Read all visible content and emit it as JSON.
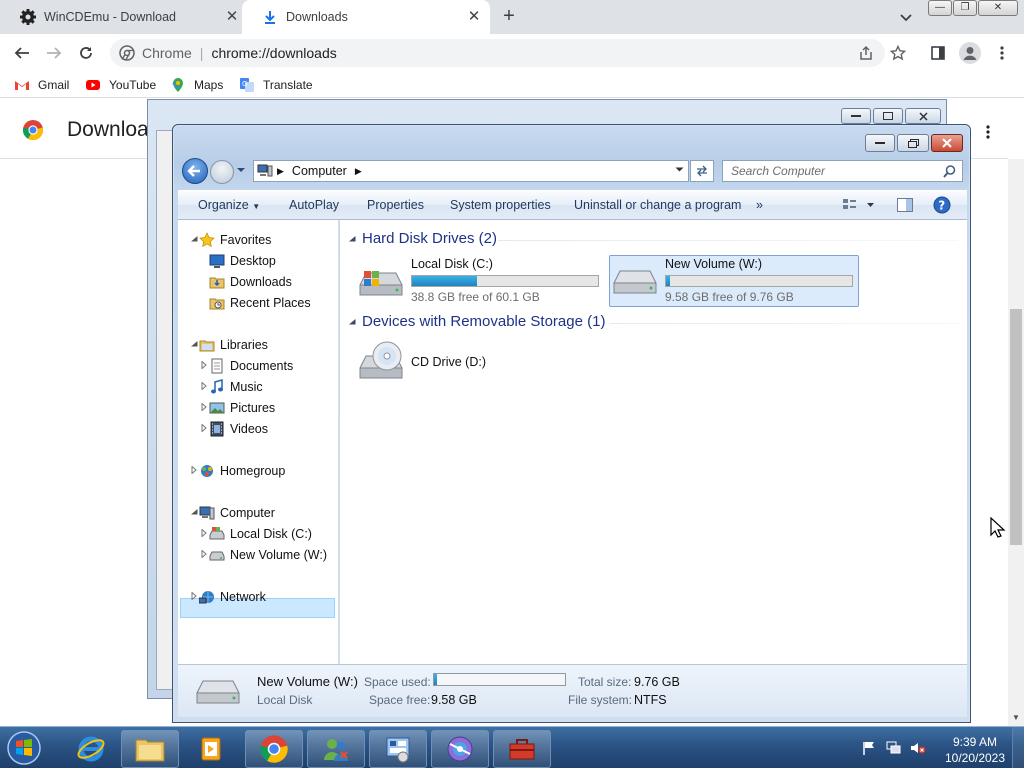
{
  "browser": {
    "tabs": [
      {
        "title": "WinCDEmu - Download",
        "active": false
      },
      {
        "title": "Downloads",
        "active": true
      }
    ],
    "omnibox": {
      "site": "Chrome",
      "url": "chrome://downloads"
    },
    "bookmarks": [
      "Gmail",
      "YouTube",
      "Maps",
      "Translate"
    ],
    "page_title": "Downloa"
  },
  "explorer": {
    "address": {
      "root": "Computer"
    },
    "search_placeholder": "Search Computer",
    "commands": [
      "Organize",
      "AutoPlay",
      "Properties",
      "System properties",
      "Uninstall or change a program"
    ],
    "nav": {
      "favorites": "Favorites",
      "desktop": "Desktop",
      "downloads": "Downloads",
      "recent": "Recent Places",
      "libraries": "Libraries",
      "documents": "Documents",
      "music": "Music",
      "pictures": "Pictures",
      "videos": "Videos",
      "homegroup": "Homegroup",
      "computer": "Computer",
      "local_disk": "Local Disk (C:)",
      "new_volume": "New Volume (W:)",
      "network": "Network"
    },
    "groups": {
      "hdd": "Hard Disk Drives (2)",
      "removable": "Devices with Removable Storage (1)"
    },
    "drives": {
      "c": {
        "name": "Local Disk (C:)",
        "free": "38.8 GB free of 60.1 GB",
        "used_fraction": 0.35
      },
      "w": {
        "name": "New Volume (W:)",
        "free": "9.58 GB free of 9.76 GB",
        "used_fraction": 0.02
      },
      "d": {
        "name": "CD Drive (D:)"
      }
    },
    "details": {
      "name": "New Volume (W:)",
      "type": "Local Disk",
      "space_used_label": "Space used:",
      "space_used_fraction": 0.02,
      "space_free_label": "Space free:",
      "space_free": "9.58 GB",
      "total_label": "Total size:",
      "total": "9.76 GB",
      "fs_label": "File system:",
      "fs": "NTFS"
    }
  },
  "taskbar": {
    "time": "9:39 AM",
    "date": "10/20/2023"
  }
}
